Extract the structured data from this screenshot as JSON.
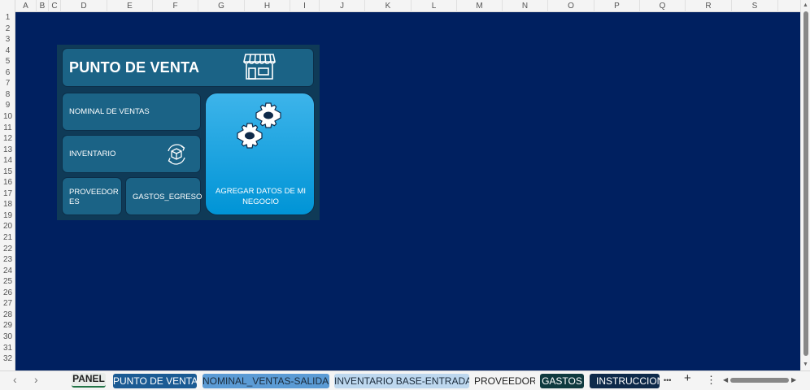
{
  "spreadsheet": {
    "columns": [
      "A",
      "B",
      "C",
      "D",
      "E",
      "F",
      "G",
      "H",
      "I",
      "J",
      "K",
      "L",
      "M",
      "N",
      "O",
      "P",
      "Q",
      "R",
      "S"
    ],
    "rows": [
      "1",
      "2",
      "3",
      "4",
      "5",
      "6",
      "7",
      "8",
      "9",
      "10",
      "11",
      "12",
      "13",
      "14",
      "15",
      "16",
      "17",
      "18",
      "19",
      "20",
      "21",
      "22",
      "23",
      "24",
      "25",
      "26",
      "27",
      "28",
      "29",
      "30",
      "31",
      "32"
    ],
    "sheet_background": "#002060"
  },
  "dashboard": {
    "title": "PUNTO DE VENTA",
    "title_icon": "store-icon",
    "buttons": {
      "nominal": "NOMINAL DE VENTAS",
      "inventario": "INVENTARIO",
      "inventario_icon": "inventory-cycle-icon",
      "proveedores_line1": "PROVEEDOR",
      "proveedores_line2": "ES",
      "gastos": "GASTOS_EGRESO",
      "agregar_line1": "AGREGAR DATOS DE MI",
      "agregar_line2": "NEGOCIO",
      "agregar_icon": "gears-icon"
    }
  },
  "tabs": {
    "items": [
      {
        "label": "PANEL",
        "active": true
      },
      {
        "label": "PUNTO DE VENTA",
        "color": "#1b5b94"
      },
      {
        "label": "NOMINAL_VENTAS-SALIDAS",
        "color": "#5b9bd5"
      },
      {
        "label": "INVENTARIO BASE-ENTRADAS",
        "color": "#bdd7ee"
      },
      {
        "label": "PROVEEDOR"
      },
      {
        "label": "GASTOS",
        "color": "#0f3a3f"
      },
      {
        "label": "INSTRUCCIONES",
        "color": "#0e2a4a"
      }
    ],
    "nav_prev": "‹",
    "nav_next": "›",
    "more": "•••",
    "add": "+",
    "options": "⋮"
  }
}
